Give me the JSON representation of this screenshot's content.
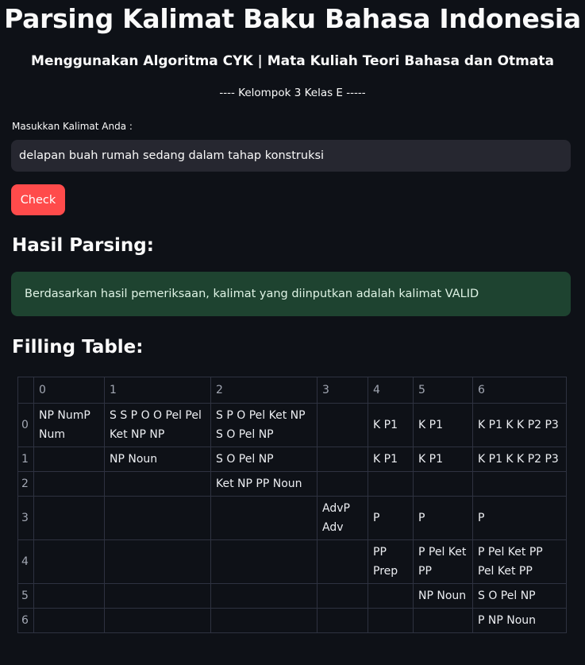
{
  "header": {
    "title": "Parsing Kalimat Baku Bahasa Indonesia",
    "subtitle": "Menggunakan Algoritma CYK | Mata Kuliah Teori Bahasa dan Otmata",
    "group": "---- Kelompok 3 Kelas E -----"
  },
  "form": {
    "input_label": "Masukkan Kalimat Anda :",
    "input_value": "delapan buah rumah sedang dalam tahap konstruksi",
    "check_label": "Check"
  },
  "result": {
    "heading": "Hasil Parsing:",
    "message": "Berdasarkan hasil pemeriksaan, kalimat yang diinputkan adalah kalimat VALID"
  },
  "table": {
    "heading": "Filling Table:",
    "columns": [
      "0",
      "1",
      "2",
      "3",
      "4",
      "5",
      "6"
    ],
    "rows": [
      {
        "index": "0",
        "cells": [
          "NP NumP Num",
          "S S P O O Pel Pel Ket NP NP",
          "S P O Pel Ket NP S O Pel NP",
          "",
          "K P1",
          "K P1",
          "K P1 K K P2 P3"
        ]
      },
      {
        "index": "1",
        "cells": [
          "",
          "NP Noun",
          "S O Pel NP",
          "",
          "K P1",
          "K P1",
          "K P1 K K P2 P3"
        ]
      },
      {
        "index": "2",
        "cells": [
          "",
          "",
          "Ket NP PP Noun",
          "",
          "",
          "",
          ""
        ]
      },
      {
        "index": "3",
        "cells": [
          "",
          "",
          "",
          "AdvP Adv",
          "P",
          "P",
          "P"
        ]
      },
      {
        "index": "4",
        "cells": [
          "",
          "",
          "",
          "",
          "PP Prep",
          "P Pel Ket PP",
          "P Pel Ket PP Pel Ket PP"
        ]
      },
      {
        "index": "5",
        "cells": [
          "",
          "",
          "",
          "",
          "",
          "NP Noun",
          "S O Pel NP"
        ]
      },
      {
        "index": "6",
        "cells": [
          "",
          "",
          "",
          "",
          "",
          "",
          "P NP Noun"
        ]
      }
    ]
  },
  "colors": {
    "background": "#0e1117",
    "accent": "#ff4b4b",
    "success_bg": "#1e4330",
    "input_bg": "#262730"
  }
}
